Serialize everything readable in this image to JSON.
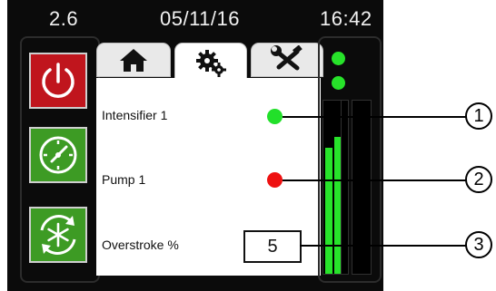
{
  "status_bar": {
    "version": "2.6",
    "date": "05/11/16",
    "time": "16:42"
  },
  "sidebar": {
    "buttons": [
      {
        "name": "power",
        "icon": "power-icon",
        "color": "#c0151d"
      },
      {
        "name": "gauge",
        "icon": "gauge-icon",
        "color": "#3d9b24"
      },
      {
        "name": "defrost",
        "icon": "snowflake-cycle-icon",
        "color": "#3d9b24"
      }
    ]
  },
  "tabs": [
    {
      "name": "home",
      "icon": "home-icon",
      "active": false
    },
    {
      "name": "settings",
      "icon": "gears-icon",
      "active": true
    },
    {
      "name": "tools",
      "icon": "wrench-screwdriver-icon",
      "active": false
    }
  ],
  "panel": {
    "rows": [
      {
        "label": "Intensifier 1",
        "status_color": "#22e02a"
      },
      {
        "label": "Pump 1",
        "status_color": "#ee1111"
      },
      {
        "label": "Overstroke %",
        "value": "5"
      }
    ]
  },
  "meters": {
    "indicator_color": "#27e32a",
    "levels": [
      0.73,
      0.79,
      0,
      0
    ]
  },
  "callouts": [
    "1",
    "2",
    "3"
  ]
}
